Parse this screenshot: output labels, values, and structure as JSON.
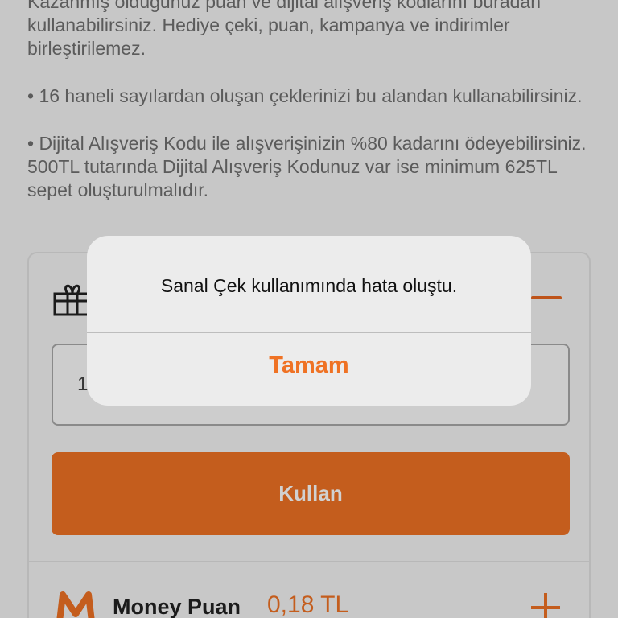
{
  "info": {
    "paragraph_1": "Kazanmış olduğunuz puan ve dijital alışveriş kodlarını buradan kullanabilirsiniz. Hediye çeki, puan, kampanya ve indirimler birleştirilemez.",
    "paragraph_2": "• 16 haneli sayılardan oluşan çeklerinizi bu alandan kullanabilirsiniz.",
    "paragraph_3": "• Dijital Alışveriş Kodu ile alışverişinizin %80 kadarını ödeyebilirsiniz. 500TL tutarında Dijital Alışveriş Kodunuz var ise minimum 625TL sepet oluşturulmalıdır."
  },
  "voucher": {
    "code_value": "1",
    "use_button_label": "Kullan"
  },
  "money": {
    "label": "Money Puan",
    "value": "0,18 TL"
  },
  "alert": {
    "message": "Sanal Çek kullanımında hata oluştu.",
    "button_label": "Tamam"
  },
  "colors": {
    "accent": "#ef7224",
    "overlay": "rgba(0,0,0,0.18)"
  },
  "icons": {
    "gift": "gift-icon",
    "collapse": "minus-icon",
    "expand": "plus-icon",
    "money_logo": "money-logo-icon"
  }
}
